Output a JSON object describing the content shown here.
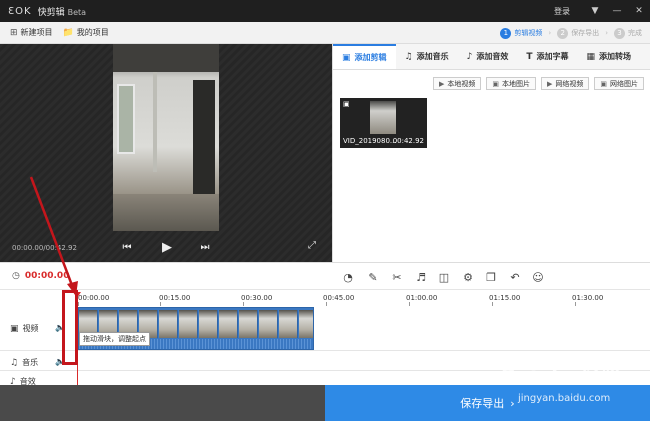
{
  "titlebar": {
    "logo": "ƐOK",
    "app_name": "快剪辑",
    "beta": "Beta",
    "login": "登录",
    "menu_icon": "menu-icon",
    "minimize_icon": "minimize-icon",
    "close_icon": "close-icon"
  },
  "menubar": {
    "new_project": "新建项目",
    "my_projects": "我的项目",
    "steps": [
      {
        "num": "1",
        "label": "剪辑视频"
      },
      {
        "num": "2",
        "label": "保存导出"
      },
      {
        "num": "3",
        "label": "完成"
      }
    ]
  },
  "preview": {
    "time_display": "00:00.00/00:42.92"
  },
  "tabs": [
    {
      "label": "添加剪辑",
      "icon": "video-camera-icon"
    },
    {
      "label": "添加音乐",
      "icon": "music-icon"
    },
    {
      "label": "添加音效",
      "icon": "sound-effect-icon"
    },
    {
      "label": "添加字幕",
      "icon": "text-icon"
    },
    {
      "label": "添加转场",
      "icon": "transition-icon"
    }
  ],
  "import_buttons": [
    "本地视频",
    "本地图片",
    "网络视频",
    "网络图片"
  ],
  "media": {
    "name": "VID_2019080...",
    "duration": "00:42.92"
  },
  "toolbar": {
    "current_time": "00:00.00"
  },
  "ruler": [
    "00:00.00",
    "00:15.00",
    "00:30.00",
    "00:45.00",
    "01:00.00",
    "01:15.00",
    "01:30.00"
  ],
  "tracks": {
    "video": "视频",
    "music": "音乐",
    "sfx": "音效"
  },
  "tooltip": "拖动滑块，调整起点",
  "bottom": {
    "save_export": "保存导出"
  },
  "watermark": {
    "text": "Bai du 经验",
    "url": "jingyan.baidu.com"
  },
  "colors": {
    "accent": "#2a7de1",
    "playhead": "#d92b2b",
    "clip": "#3b78c2",
    "save_button": "#2e8ae6",
    "annotation": "#c4161c"
  }
}
